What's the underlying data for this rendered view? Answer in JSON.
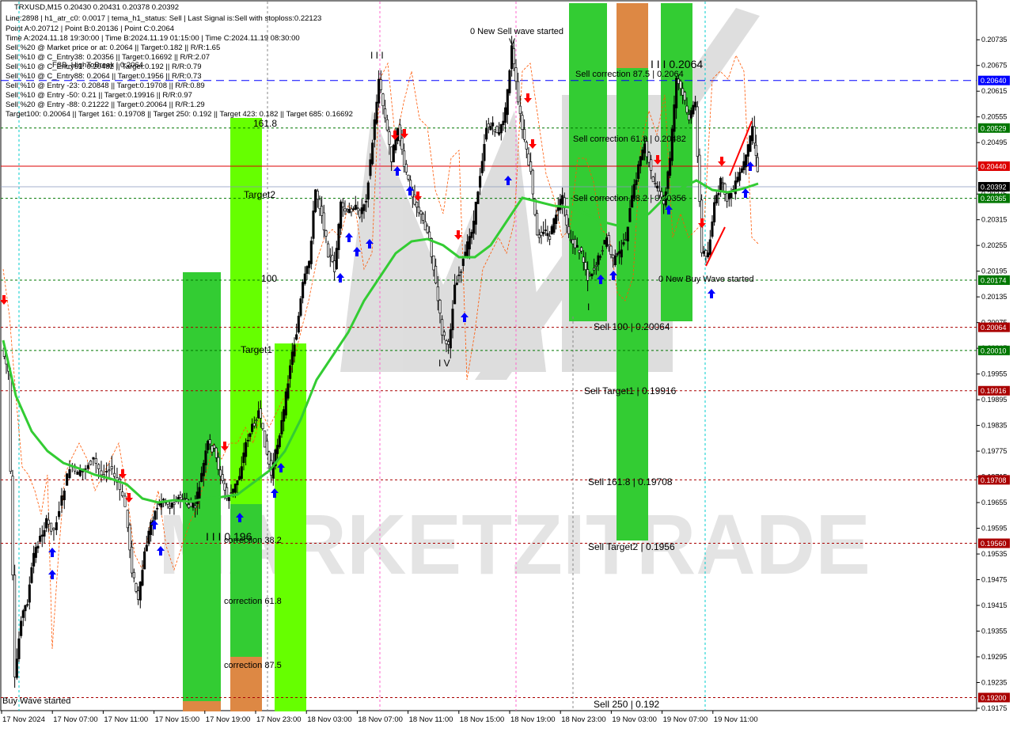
{
  "header": {
    "symbol_line": "TRXUSD,M15  0.20430 0.20431 0.20378 0.20392",
    "info_lines": [
      "Line:2898 | h1_atr_c0: 0.0017 | tema_h1_status: Sell | Last Signal is:Sell with stoploss:0.22123",
      "Point A:0.20712 | Point B:0.20136 | Point C:0.2064",
      "Time A:2024.11.18 19:30:00 | Time B:2024.11.19 01:15:00 | Time C:2024.11.19 08:30:00",
      "Sell %20 @ Market price or at: 0.2064 || Target:0.182 || R/R:1.65",
      "Sell %10 @ C_Entry38: 0.20356 || Target:0.16692 || R/R:2.07",
      "Sell %10 @ C_Entry61: 0.20482 || Target:0.192 || R/R:0.79",
      "Sell %10 @ C_Entry88: 0.2064 || Target:0.1956 || R/R:0.73",
      "Sell %10 @ Entry -23: 0.20848 || Target:0.19708 || R/R:0.89",
      "Sell %10 @ Entry -50: 0.21 || Target:0.19916 || R/R:0.97",
      "Sell %20 @ Entry -88: 0.21222 || Target:0.20064 || R/R:1.29",
      "Target100: 0.20064 || Target 161: 0.19708 || Target 250: 0.192 || Target 423: 0.182 || Target 685: 0.16692"
    ],
    "overlay_label": "FSB_HighToBreak | 0.2064"
  },
  "colors": {
    "green_zone": "#33cc33",
    "lime_zone": "#66ff00",
    "orange_zone": "#dd8844",
    "ma_line": "#33cc33",
    "red_line": "#dd0000",
    "blue_dash": "#0000ff",
    "green_dash": "#007700",
    "red_dash": "#aa0000",
    "up_arrow": "#0000ff",
    "down_arrow": "#ff0000"
  },
  "chart_data": {
    "type": "candlestick",
    "symbol": "TRXUSD",
    "timeframe": "M15",
    "ylim": [
      0.19175,
      0.20765
    ],
    "y_ticks": [
      "0.20735",
      "0.20675",
      "0.20615",
      "0.20555",
      "0.20495",
      "0.20435",
      "0.20375",
      "0.20315",
      "0.20255",
      "0.20195",
      "0.20135",
      "0.20075",
      "0.20015",
      "0.19955",
      "0.19895",
      "0.19835",
      "0.19775",
      "0.19715",
      "0.19655",
      "0.19595",
      "0.19535",
      "0.19475",
      "0.19415",
      "0.19355",
      "0.19295",
      "0.19235",
      "0.19175"
    ],
    "x_ticks": [
      "17 Nov 2024",
      "17 Nov 07:00",
      "17 Nov 11:00",
      "17 Nov 15:00",
      "17 Nov 19:00",
      "17 Nov 23:00",
      "18 Nov 03:00",
      "18 Nov 07:00",
      "18 Nov 11:00",
      "18 Nov 15:00",
      "18 Nov 19:00",
      "18 Nov 23:00",
      "19 Nov 03:00",
      "19 Nov 07:00",
      "19 Nov 11:00"
    ],
    "price_levels": [
      {
        "value": "0.20640",
        "color": "#0000ff",
        "style": "dashed"
      },
      {
        "value": "0.20529",
        "color": "#007700",
        "style": "dotted"
      },
      {
        "value": "0.20440",
        "color": "#dd0000",
        "style": "solid"
      },
      {
        "value": "0.20392",
        "color": "#000000",
        "style": "current"
      },
      {
        "value": "0.20365",
        "color": "#007700",
        "style": "dotted"
      },
      {
        "value": "0.20174",
        "color": "#007700",
        "style": "dotted"
      },
      {
        "value": "0.20064",
        "color": "#aa0000",
        "style": "dotted"
      },
      {
        "value": "0.20010",
        "color": "#007700",
        "style": "dotted"
      },
      {
        "value": "0.19916",
        "color": "#aa0000",
        "style": "dotted"
      },
      {
        "value": "0.19708",
        "color": "#aa0000",
        "style": "dotted"
      },
      {
        "value": "0.19560",
        "color": "#aa0000",
        "style": "dotted"
      },
      {
        "value": "0.19200",
        "color": "#aa0000",
        "style": "dotted"
      }
    ],
    "annotations": [
      {
        "text": "0 New Sell wave started",
        "color": "#000000"
      },
      {
        "text": "I I I 0.2064",
        "color": "#000000"
      },
      {
        "text": "Sell correction 87.5 | 0.2064",
        "color": "#006600"
      },
      {
        "text": "Sell correction 61.8 | 0.20482",
        "color": "#006600"
      },
      {
        "text": "Sell correction 38.2 | 0.20356",
        "color": "#006600"
      },
      {
        "text": "0 New Buy Wave started",
        "color": "#0000cc"
      },
      {
        "text": "Sell 100 | 0.20064",
        "color": "#aa0000"
      },
      {
        "text": "Sell Target1 | 0.19916",
        "color": "#aa0000"
      },
      {
        "text": "Sell 161.8 | 0.19708",
        "color": "#aa0000"
      },
      {
        "text": "Sell Target2 | 0.1956",
        "color": "#aa0000"
      },
      {
        "text": "Sell  250 | 0.192",
        "color": "#aa0000"
      },
      {
        "text": "161.8",
        "color": "#006600"
      },
      {
        "text": "Target2",
        "color": "#006600"
      },
      {
        "text": "100",
        "color": "#006600"
      },
      {
        "text": "Target1",
        "color": "#006600"
      },
      {
        "text": "I I I 0.196",
        "color": "#000000"
      },
      {
        "text": "correction 38.2",
        "color": "#0000cc"
      },
      {
        "text": "correction 61.8",
        "color": "#0000cc"
      },
      {
        "text": "correction 87.5",
        "color": "#0000cc"
      },
      {
        "text": "Buy Wave started",
        "color": "#0000cc"
      },
      {
        "text": "I I I",
        "color": "#0000cc"
      },
      {
        "text": "I V",
        "color": "#0000cc"
      },
      {
        "text": "V",
        "color": "#0000cc"
      },
      {
        "text": "I",
        "color": "#000000"
      }
    ],
    "watermark": "MARKETZITRADE"
  }
}
